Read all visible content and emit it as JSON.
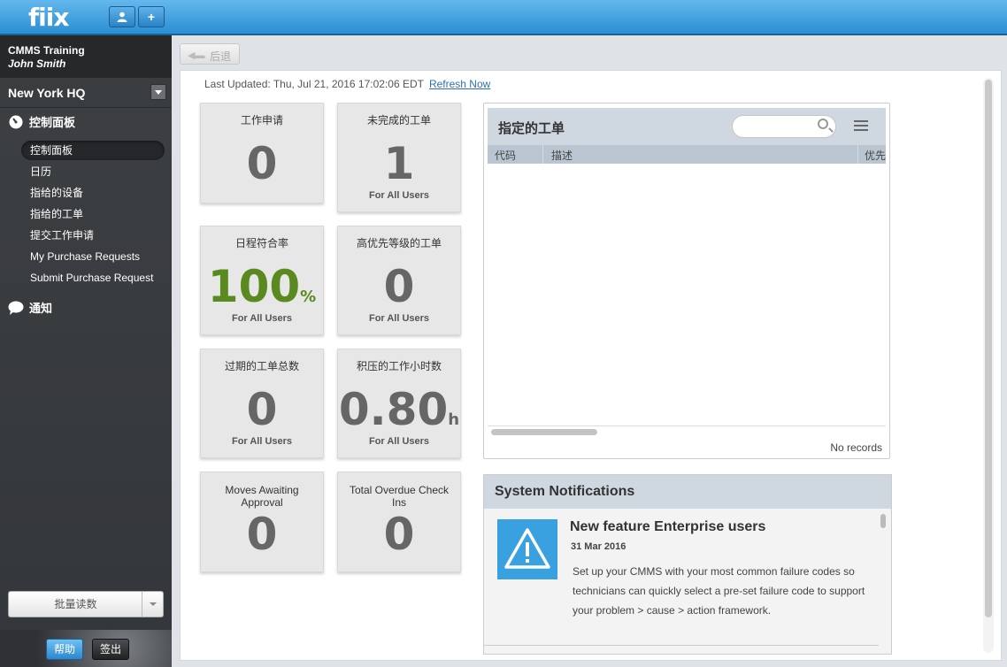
{
  "app": {
    "logo": "fiix"
  },
  "topbar": {
    "user_button_icon": "user-icon",
    "add_button_label": "+"
  },
  "sidebar": {
    "org": "CMMS Training",
    "user": "John Smith",
    "site": "New York HQ",
    "dashboard_section": "控制面板",
    "items": [
      {
        "label": "控制面板",
        "active": true
      },
      {
        "label": "日历"
      },
      {
        "label": "指给的设备"
      },
      {
        "label": "指给的工单"
      },
      {
        "label": "提交工作申请"
      },
      {
        "label": "My Purchase Requests"
      },
      {
        "label": "Submit Purchase Request"
      }
    ],
    "notifications_section": "通知",
    "bulk_button": "批量读数",
    "help": "帮助",
    "logout": "签出"
  },
  "toolbar": {
    "back_label": "后退"
  },
  "dashboard": {
    "last_updated": "Last Updated: Thu, Jul 21, 2016 17:02:06 EDT",
    "refresh": "Refresh Now",
    "tiles": [
      {
        "title": "工作申请",
        "value": "0",
        "unit": "",
        "sub": ""
      },
      {
        "title": "未完成的工单",
        "value": "1",
        "unit": "",
        "sub": "For All Users"
      },
      {
        "title": "日程符合率",
        "value": "100",
        "unit": "%",
        "sub": "For All Users"
      },
      {
        "title": "高优先等级的工单",
        "value": "0",
        "unit": "",
        "sub": "For All Users"
      },
      {
        "title": "过期的工单总数",
        "value": "0",
        "unit": "",
        "sub": "For All Users"
      },
      {
        "title": "积压的工作小时数",
        "value": "0.80",
        "unit": "h",
        "sub": "For All Users"
      },
      {
        "title": "Moves Awaiting Approval",
        "value": "0",
        "unit": "",
        "sub": ""
      },
      {
        "title": "Total Overdue Check Ins",
        "value": "0",
        "unit": "",
        "sub": ""
      }
    ]
  },
  "work_orders": {
    "title": "指定的工单",
    "search_placeholder": "",
    "columns": [
      "代码",
      "描述",
      "优先"
    ],
    "records": "No records"
  },
  "notifications": {
    "title": "System Notifications",
    "item_title": "New feature Enterprise users",
    "date": "31 Mar 2016",
    "body": "Set up your CMMS with your most common failure codes so technicians can quickly select a pre-set failure code to support your problem > cause > action framework."
  },
  "colors": {
    "topbar": "#2b8ed4",
    "sidebar": "#3d4043",
    "accent_green": "#5a8a1f",
    "link": "#2a72b5",
    "warning_tile": "#3aa1e0"
  }
}
